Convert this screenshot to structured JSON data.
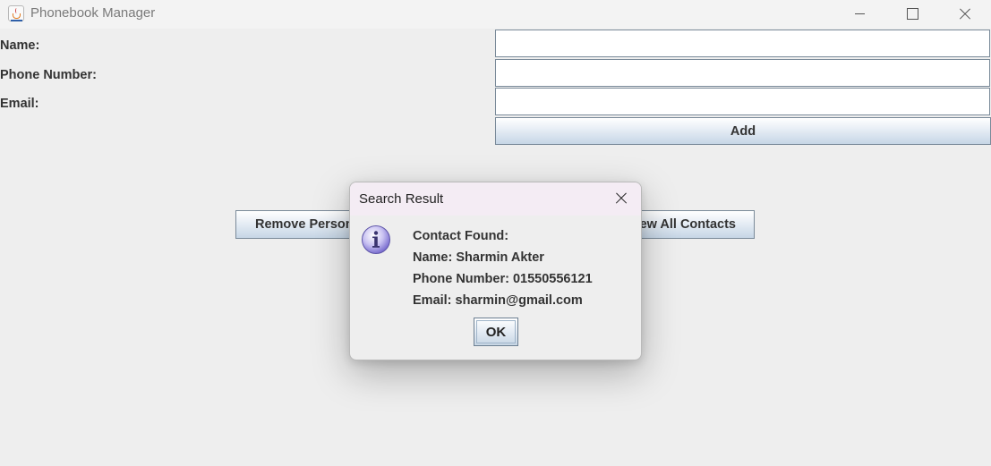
{
  "window": {
    "title": "Phonebook Manager",
    "app_icon": "java-cup-icon",
    "controls": [
      "minimize-icon",
      "maximize-icon",
      "close-icon"
    ]
  },
  "form": {
    "name_label": "Name:",
    "name_value": "",
    "phone_label": "Phone Number:",
    "phone_value": "",
    "email_label": "Email:",
    "email_value": "",
    "add_label": "Add"
  },
  "actions": {
    "remove_label": "Remove Person",
    "view_all_label": "View All Contacts"
  },
  "dialog": {
    "title": "Search Result",
    "icon": "info-icon",
    "lines": [
      "Contact Found:",
      "Name: Sharmin Akter",
      "Phone Number: 01550556121",
      "Email: sharmin@gmail.com"
    ],
    "ok_label": "OK"
  },
  "colors": {
    "background": "#eeeeee",
    "button_gradient_top": "#ffffff",
    "button_gradient_bottom": "#c6d6e6",
    "dialog_titlebar": "#f4ecf4",
    "info_icon": "#7b6fd0"
  }
}
